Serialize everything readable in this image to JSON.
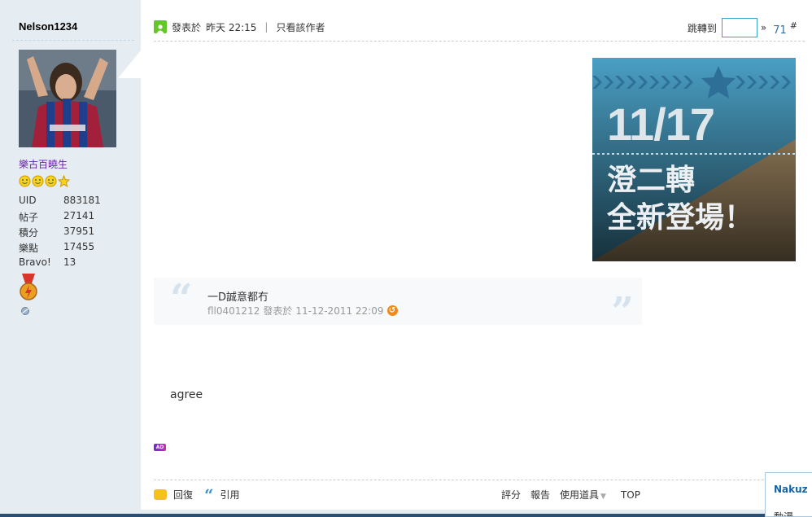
{
  "author": {
    "name": "Nelson1234",
    "group": "樂古百曉生",
    "stats": [
      {
        "label": "UID",
        "value": "883181"
      },
      {
        "label": "帖子",
        "value": "27141"
      },
      {
        "label": "積分",
        "value": "37951"
      },
      {
        "label": "樂點",
        "value": "17455"
      },
      {
        "label": "Bravo!",
        "value": "13"
      }
    ]
  },
  "post": {
    "posted_prefix": "發表於",
    "posted_time": "昨天 22:15",
    "separator": "|",
    "only_author": "只看該作者",
    "jump_label": "跳轉到",
    "jump_arrow": "»",
    "floor": "71",
    "floor_suffix": "#",
    "body": "agree",
    "ad_label": "AD"
  },
  "banner": {
    "date": "11/17",
    "line1": "澄二轉",
    "line2": "全新登場！"
  },
  "quote": {
    "text": "一D誠意都冇",
    "author": "fll0401212",
    "posted_prefix": "發表於",
    "time": "11-12-2011 22:09"
  },
  "footer": {
    "reply": "回復",
    "quote": "引用",
    "rate": "評分",
    "report": "報告",
    "tools": "使用道具",
    "top": "TOP"
  },
  "corner": {
    "title": "Nakuz",
    "subtitle": "動漫"
  },
  "colors": {
    "sidebar_bg": "#e5edf2",
    "link_purple": "#6a24a8",
    "accent_blue": "#3b9ec7",
    "floor_blue": "#3672a6"
  }
}
